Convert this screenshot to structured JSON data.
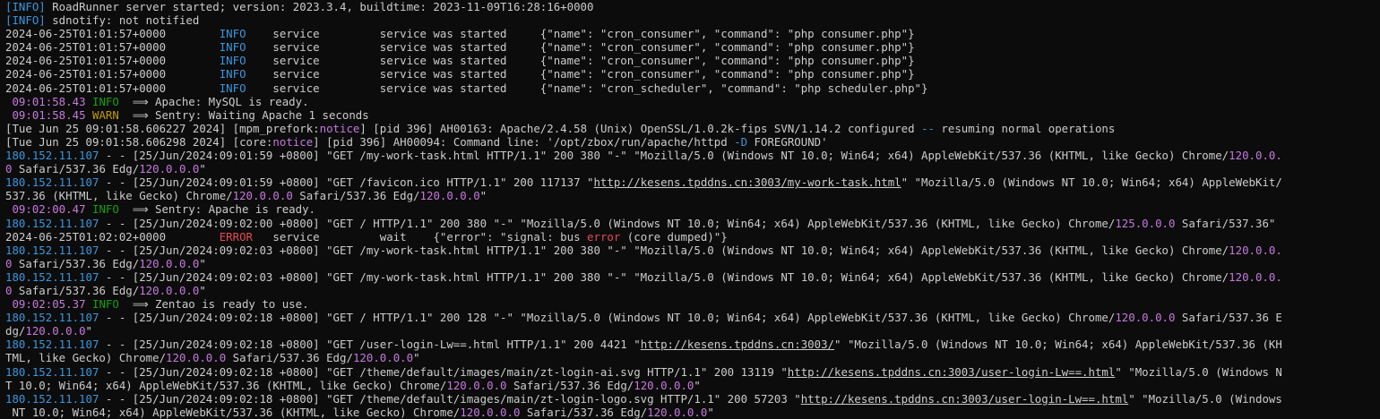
{
  "terminal": {
    "lines": [
      [
        {
          "t": "[INFO]",
          "c": "info"
        },
        {
          "t": " RoadRunner server started; version: 2023.3.4, buildtime: 2023-11-09T16:28:16+0000"
        }
      ],
      [
        {
          "t": "[INFO]",
          "c": "info"
        },
        {
          "t": " sdnotify: not notified"
        }
      ],
      [
        {
          "t": "2024-06-25T01:01:57+0000        "
        },
        {
          "t": "INFO",
          "c": "blue"
        },
        {
          "t": "    service         service was started     {\"name\": \"cron_consumer\", \"command\": \"php consumer.php\"}"
        }
      ],
      [
        {
          "t": "2024-06-25T01:01:57+0000        "
        },
        {
          "t": "INFO",
          "c": "blue"
        },
        {
          "t": "    service         service was started     {\"name\": \"cron_consumer\", \"command\": \"php consumer.php\"}"
        }
      ],
      [
        {
          "t": "2024-06-25T01:01:57+0000        "
        },
        {
          "t": "INFO",
          "c": "blue"
        },
        {
          "t": "    service         service was started     {\"name\": \"cron_consumer\", \"command\": \"php consumer.php\"}"
        }
      ],
      [
        {
          "t": "2024-06-25T01:01:57+0000        "
        },
        {
          "t": "INFO",
          "c": "blue"
        },
        {
          "t": "    service         service was started     {\"name\": \"cron_consumer\", \"command\": \"php consumer.php\"}"
        }
      ],
      [
        {
          "t": "2024-06-25T01:01:57+0000        "
        },
        {
          "t": "INFO",
          "c": "blue"
        },
        {
          "t": "    service         service was started     {\"name\": \"cron_scheduler\", \"command\": \"php scheduler.php\"}"
        }
      ],
      [
        {
          "t": " "
        },
        {
          "t": "09:01:58.43",
          "c": "mag"
        },
        {
          "t": " "
        },
        {
          "t": "INFO",
          "c": "lvl-info"
        },
        {
          "t": "  ⟹ Apache: MySQL is ready."
        }
      ],
      [
        {
          "t": " "
        },
        {
          "t": "09:01:58.45",
          "c": "mag"
        },
        {
          "t": " "
        },
        {
          "t": "WARN",
          "c": "lvl-warn"
        },
        {
          "t": "  ⟹ Sentry: Waiting Apache 1 seconds"
        }
      ],
      [
        {
          "t": "[Tue Jun 25 09:01:58.606227 2024] [mpm_prefork:"
        },
        {
          "t": "notice",
          "c": "mag"
        },
        {
          "t": "] [pid 396] AH00163: Apache/2.4.58 (Unix) OpenSSL/1.0.2k-fips SVN/1.14.2 configured "
        },
        {
          "t": "--",
          "c": "blue"
        },
        {
          "t": " resuming normal operations"
        }
      ],
      [
        {
          "t": "[Tue Jun 25 09:01:58.606298 2024] [core:"
        },
        {
          "t": "notice",
          "c": "mag"
        },
        {
          "t": "] [pid 396] AH00094: Command line: '/opt/zbox/run/apache/httpd "
        },
        {
          "t": "-D",
          "c": "blue"
        },
        {
          "t": " FOREGROUND'"
        }
      ],
      [
        {
          "t": "180.152.11.107",
          "c": "ip"
        },
        {
          "t": " - - [25/Jun/2024:09:01:59 +0800] \"GET /my-work-task.html HTTP/1.1\" 200 380 \"-\" \"Mozilla/5.0 (Windows NT 10.0; Win64; x64) AppleWebKit/537.36 (KHTML, like Gecko) Chrome/"
        },
        {
          "t": "120.0.0.",
          "c": "mag"
        }
      ],
      [
        {
          "t": "0",
          "c": "mag"
        },
        {
          "t": " Safari/537.36 Edg/"
        },
        {
          "t": "120.0.0.0",
          "c": "mag"
        },
        {
          "t": "\""
        }
      ],
      [
        {
          "t": "180.152.11.107",
          "c": "ip"
        },
        {
          "t": " - - [25/Jun/2024:09:01:59 +0800] \"GET /favicon.ico HTTP/1.1\" 200 117137 \""
        },
        {
          "t": "http://kesens.tpddns.cn:3003/my-work-task.html",
          "c": "link"
        },
        {
          "t": "\" \"Mozilla/5.0 (Windows NT 10.0; Win64; x64) AppleWebKit/"
        }
      ],
      [
        {
          "t": "537.36 (KHTML, like Gecko) Chrome/"
        },
        {
          "t": "120.0.0.0",
          "c": "mag"
        },
        {
          "t": " Safari/537.36 Edg/"
        },
        {
          "t": "120.0.0.0",
          "c": "mag"
        },
        {
          "t": "\""
        }
      ],
      [
        {
          "t": " "
        },
        {
          "t": "09:02:00.47",
          "c": "mag"
        },
        {
          "t": " "
        },
        {
          "t": "INFO",
          "c": "lvl-info"
        },
        {
          "t": "  ⟹ Sentry: Apache is ready."
        }
      ],
      [
        {
          "t": "180.152.11.107",
          "c": "ip"
        },
        {
          "t": " - - [25/Jun/2024:09:02:00 +0800] \"GET / HTTP/1.1\" 200 380 \"-\" \"Mozilla/5.0 (Windows NT 10.0; Win64; x64) AppleWebKit/537.36 (KHTML, like Gecko) Chrome/"
        },
        {
          "t": "125.0.0.0",
          "c": "mag"
        },
        {
          "t": " Safari/537.36\""
        }
      ],
      [
        {
          "t": "2024-06-25T01:02:02+0000        "
        },
        {
          "t": "ERROR",
          "c": "red"
        },
        {
          "t": "   service         wait    {\"error\": \"signal: bus "
        },
        {
          "t": "error",
          "c": "red"
        },
        {
          "t": " (core dumped)\"}"
        }
      ],
      [
        {
          "t": "180.152.11.107",
          "c": "ip"
        },
        {
          "t": " - - [25/Jun/2024:09:02:03 +0800] \"GET /my-work-task.html HTTP/1.1\" 200 380 \"-\" \"Mozilla/5.0 (Windows NT 10.0; Win64; x64) AppleWebKit/537.36 (KHTML, like Gecko) Chrome/"
        },
        {
          "t": "120.0.0.",
          "c": "mag"
        }
      ],
      [
        {
          "t": "0",
          "c": "mag"
        },
        {
          "t": " Safari/537.36 Edg/"
        },
        {
          "t": "120.0.0.0",
          "c": "mag"
        },
        {
          "t": "\""
        }
      ],
      [
        {
          "t": "180.152.11.107",
          "c": "ip"
        },
        {
          "t": " - - [25/Jun/2024:09:02:03 +0800] \"GET /my-work-task.html HTTP/1.1\" 200 380 \"-\" \"Mozilla/5.0 (Windows NT 10.0; Win64; x64) AppleWebKit/537.36 (KHTML, like Gecko) Chrome/"
        },
        {
          "t": "120.0.0.",
          "c": "mag"
        }
      ],
      [
        {
          "t": "0",
          "c": "mag"
        },
        {
          "t": " Safari/537.36 Edg/"
        },
        {
          "t": "120.0.0.0",
          "c": "mag"
        },
        {
          "t": "\""
        }
      ],
      [
        {
          "t": " "
        },
        {
          "t": "09:02:05.37",
          "c": "mag"
        },
        {
          "t": " "
        },
        {
          "t": "INFO",
          "c": "lvl-info"
        },
        {
          "t": "  ⟹ Zentao is ready to use."
        }
      ],
      [
        {
          "t": "180.152.11.107",
          "c": "ip"
        },
        {
          "t": " - - [25/Jun/2024:09:02:18 +0800] \"GET / HTTP/1.1\" 200 128 \"-\" \"Mozilla/5.0 (Windows NT 10.0; Win64; x64) AppleWebKit/537.36 (KHTML, like Gecko) Chrome/"
        },
        {
          "t": "120.0.0.0",
          "c": "mag"
        },
        {
          "t": " Safari/537.36 E"
        }
      ],
      [
        {
          "t": "dg/"
        },
        {
          "t": "120.0.0.0",
          "c": "mag"
        },
        {
          "t": "\""
        }
      ],
      [
        {
          "t": "180.152.11.107",
          "c": "ip"
        },
        {
          "t": " - - [25/Jun/2024:09:02:18 +0800] \"GET /user-login-Lw==.html HTTP/1.1\" 200 4421 \""
        },
        {
          "t": "http://kesens.tpddns.cn:3003/",
          "c": "link"
        },
        {
          "t": "\" \"Mozilla/5.0 (Windows NT 10.0; Win64; x64) AppleWebKit/537.36 (KH"
        }
      ],
      [
        {
          "t": "TML, like Gecko) Chrome/"
        },
        {
          "t": "120.0.0.0",
          "c": "mag"
        },
        {
          "t": " Safari/537.36 Edg/"
        },
        {
          "t": "120.0.0.0",
          "c": "mag"
        },
        {
          "t": "\""
        }
      ],
      [
        {
          "t": "180.152.11.107",
          "c": "ip"
        },
        {
          "t": " - - [25/Jun/2024:09:02:18 +0800] \"GET /theme/default/images/main/zt-login-ai.svg HTTP/1.1\" 200 13119 \""
        },
        {
          "t": "http://kesens.tpddns.cn:3003/user-login-Lw==.html",
          "c": "link"
        },
        {
          "t": "\" \"Mozilla/5.0 (Windows N"
        }
      ],
      [
        {
          "t": "T 10.0; Win64; x64) AppleWebKit/537.36 (KHTML, like Gecko) Chrome/"
        },
        {
          "t": "120.0.0.0",
          "c": "mag"
        },
        {
          "t": " Safari/537.36 Edg/"
        },
        {
          "t": "120.0.0.0",
          "c": "mag"
        },
        {
          "t": "\""
        }
      ],
      [
        {
          "t": "180.152.11.107",
          "c": "ip"
        },
        {
          "t": " - - [25/Jun/2024:09:02:18 +0800] \"GET /theme/default/images/main/zt-login-logo.svg HTTP/1.1\" 200 57203 \""
        },
        {
          "t": "http://kesens.tpddns.cn:3003/user-login-Lw==.html",
          "c": "link"
        },
        {
          "t": "\" \"Mozilla/5.0 (Windows"
        }
      ],
      [
        {
          "t": " NT 10.0; Win64; x64) AppleWebKit/537.36 (KHTML, like Gecko) Chrome/"
        },
        {
          "t": "120.0.0.0",
          "c": "mag"
        },
        {
          "t": " Safari/537.36 Edg/"
        },
        {
          "t": "120.0.0.0",
          "c": "mag"
        },
        {
          "t": "\""
        }
      ]
    ]
  }
}
